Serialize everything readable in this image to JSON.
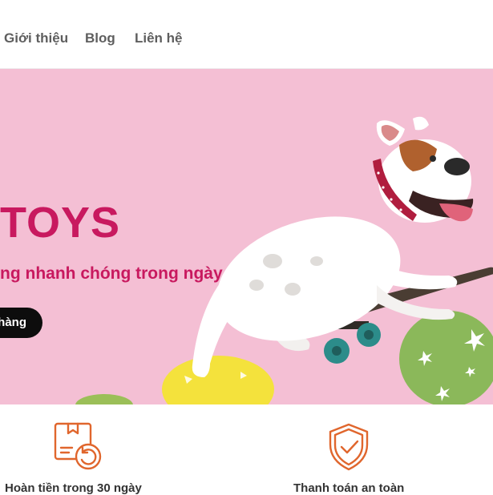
{
  "nav": {
    "items": [
      {
        "label": "Giới thiệu"
      },
      {
        "label": "Blog"
      },
      {
        "label": "Liên hệ"
      }
    ]
  },
  "hero": {
    "title": "TOYS",
    "subtitle": "ng nhanh chóng trong ngày",
    "button_label": "hàng",
    "background_color": "#f4bfd4",
    "accent_color": "#c8195f"
  },
  "features": [
    {
      "icon": "package-return-icon",
      "label": "Hoàn tiền trong 30 ngày"
    },
    {
      "icon": "shield-check-icon",
      "label": "Thanh toán an toàn"
    }
  ],
  "colors": {
    "icon_orange": "#e0662d",
    "button_dark": "#0d0d0d"
  }
}
